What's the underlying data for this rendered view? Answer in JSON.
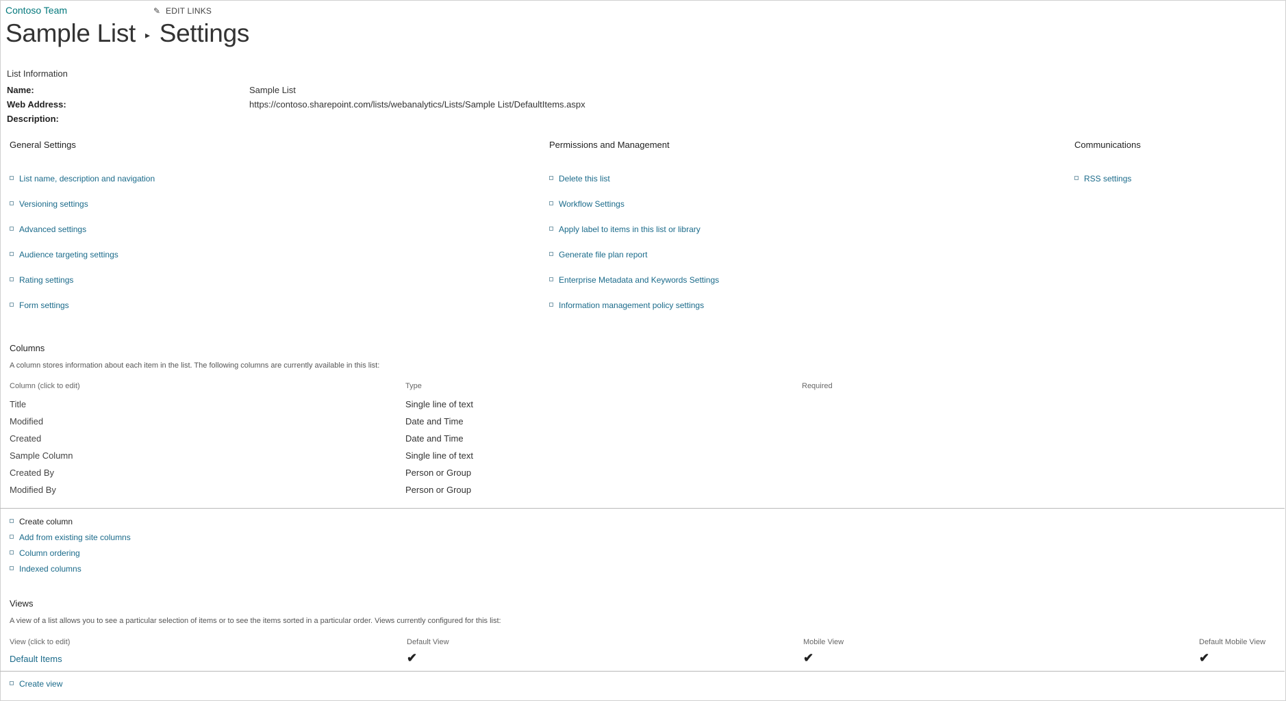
{
  "breadcrumb": {
    "site": "Contoso  Team",
    "edit_links": "EDIT LINKS"
  },
  "title": {
    "part1": "Sample List",
    "separator": "▸",
    "part2": "Settings"
  },
  "list_information": {
    "heading": "List Information",
    "name_label": "Name:",
    "name_value": "Sample List",
    "web_address_label": "Web Address:",
    "web_address_value": "https://contoso.sharepoint.com/lists/webanalytics/Lists/Sample List/DefaultItems.aspx",
    "description_label": "Description:"
  },
  "general_settings": {
    "heading": "General Settings",
    "items": [
      "List name, description and navigation",
      "Versioning settings",
      "Advanced settings",
      "Audience targeting settings",
      "Rating settings",
      "Form settings"
    ]
  },
  "permissions": {
    "heading": "Permissions and Management",
    "items": [
      "Delete this list",
      "Workflow Settings",
      "Apply label to items in this list or library",
      "Generate file plan report",
      "Enterprise Metadata and Keywords Settings",
      "Information management policy settings"
    ]
  },
  "communications": {
    "heading": "Communications",
    "items": [
      "RSS settings"
    ]
  },
  "columns": {
    "heading": "Columns",
    "description": "A column stores information about each item in the list. The following columns are currently available in this list:",
    "headers": [
      "Column (click to edit)",
      "Type",
      "Required"
    ],
    "rows": [
      {
        "name": "Title",
        "type": "Single line of text"
      },
      {
        "name": "Modified",
        "type": "Date and Time"
      },
      {
        "name": "Created",
        "type": "Date and Time"
      },
      {
        "name": "Sample Column",
        "type": "Single line of text"
      },
      {
        "name": "Created By",
        "type": "Person or Group"
      },
      {
        "name": "Modified By",
        "type": "Person or Group"
      }
    ],
    "actions": [
      "Create column",
      "Add from existing site columns",
      "Column ordering",
      "Indexed columns"
    ]
  },
  "views": {
    "heading": "Views",
    "description": "A view of a list allows you to see a particular selection of items or to see the items sorted in a particular order. Views currently configured for this list:",
    "headers": [
      "View (click to edit)",
      "Default View",
      "Mobile View",
      "Default Mobile View"
    ],
    "rows": [
      {
        "name": "Default Items"
      }
    ],
    "check": "✔",
    "actions": [
      "Create view"
    ]
  },
  "colors": {
    "link": "#1a6a8a",
    "site": "#03787c"
  },
  "icons": {
    "edit": "pencil-icon",
    "bullet": "square-bullet-icon",
    "check": "checkmark-icon"
  }
}
